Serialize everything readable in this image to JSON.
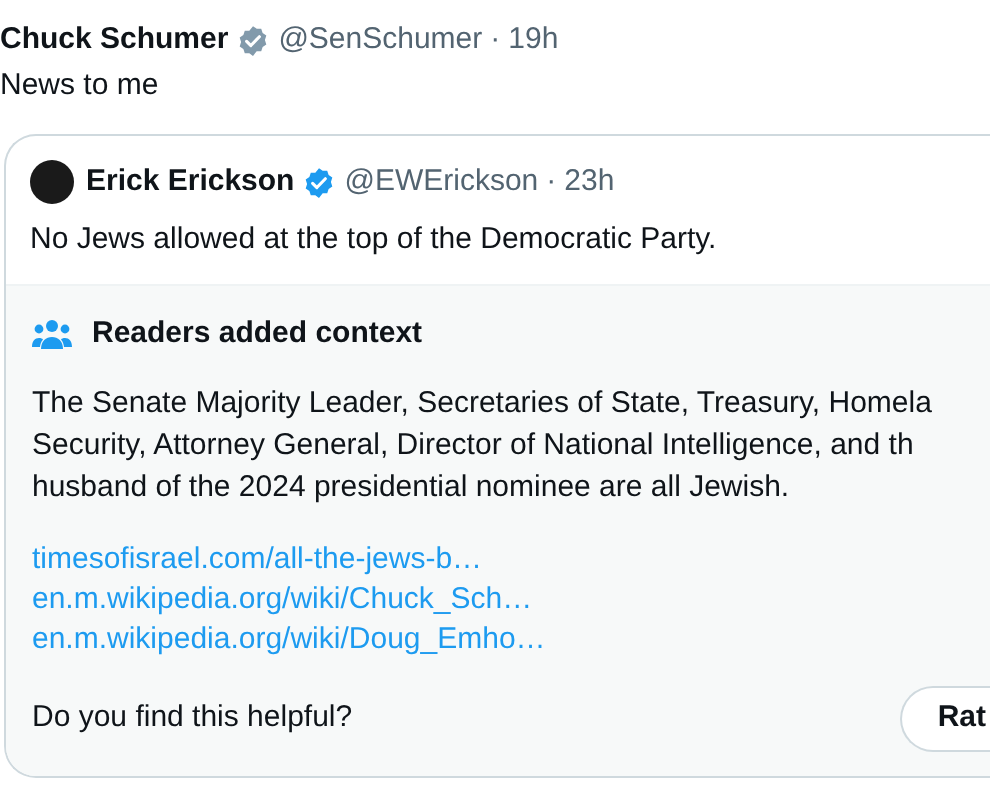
{
  "tweet": {
    "name": "Chuck Schumer",
    "verified": true,
    "handle": "@SenSchumer",
    "dot": "·",
    "time": "19h",
    "text": "News to me"
  },
  "quoted": {
    "name": "Erick Erickson",
    "verified": true,
    "handle": "@EWErickson",
    "dot": "·",
    "time": "23h",
    "text": "No Jews allowed at the top of the Democratic Party."
  },
  "context": {
    "title": "Readers added context",
    "lines": [
      "The Senate Majority Leader, Secretaries of State, Treasury, Homela",
      "Security, Attorney General, Director of National Intelligence, and th",
      "husband of the 2024 presidential nominee are all Jewish."
    ],
    "links": [
      "timesofisrael.com/all-the-jews-b…",
      "en.m.wikipedia.org/wiki/Chuck_Sch…",
      "en.m.wikipedia.org/wiki/Doug_Emho…"
    ],
    "question": "Do you find this helpful?",
    "button": "Rat"
  }
}
